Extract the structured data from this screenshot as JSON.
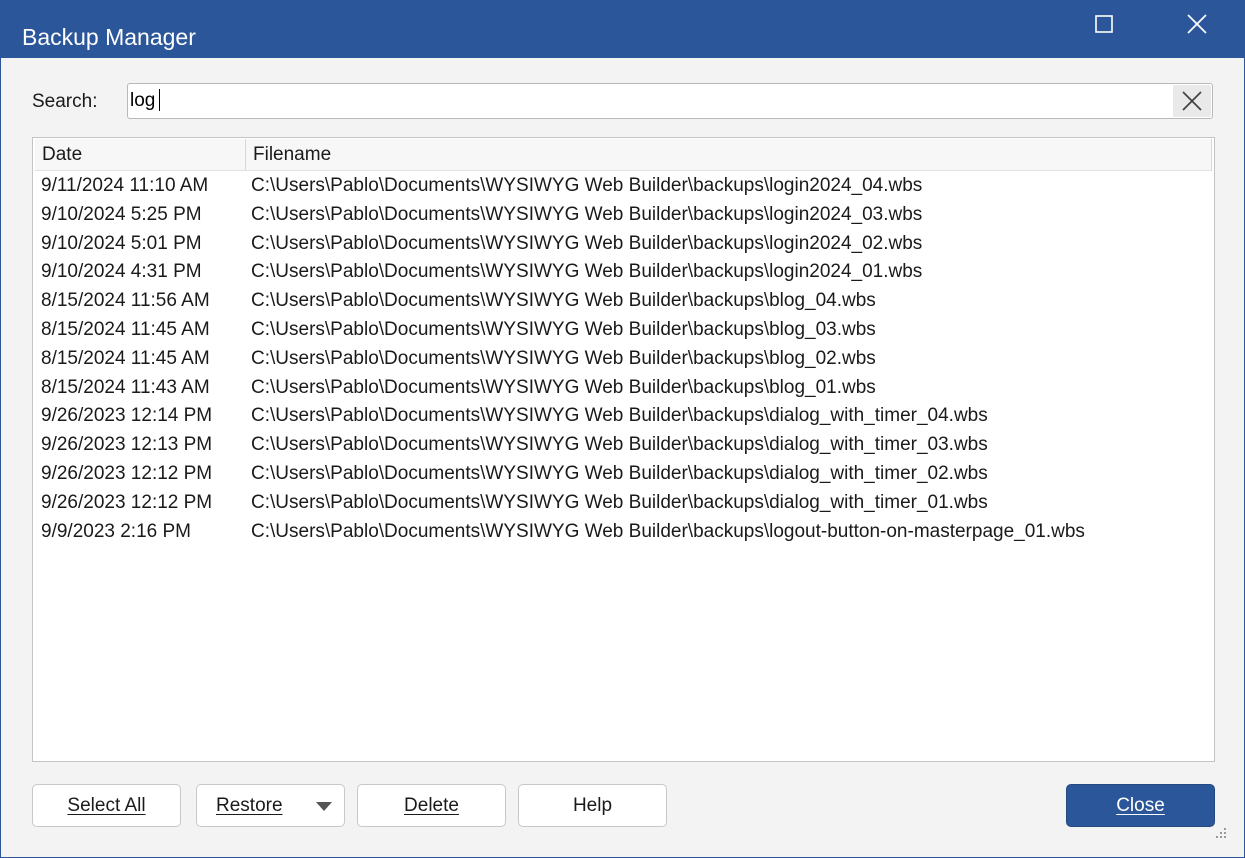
{
  "window": {
    "title": "Backup Manager",
    "maximize_icon": "maximize-icon",
    "close_icon": "close-icon",
    "accent": "#2b579a"
  },
  "search": {
    "label": "Search:",
    "value": "log",
    "clear_icon": "clear-x-icon"
  },
  "table": {
    "columns": [
      "Date",
      "Filename"
    ],
    "rows": [
      {
        "date": "9/11/2024 11:10 AM",
        "filename": "C:\\Users\\Pablo\\Documents\\WYSIWYG Web Builder\\backups\\login2024_04.wbs"
      },
      {
        "date": "9/10/2024 5:25 PM",
        "filename": "C:\\Users\\Pablo\\Documents\\WYSIWYG Web Builder\\backups\\login2024_03.wbs"
      },
      {
        "date": "9/10/2024 5:01 PM",
        "filename": "C:\\Users\\Pablo\\Documents\\WYSIWYG Web Builder\\backups\\login2024_02.wbs"
      },
      {
        "date": "9/10/2024 4:31 PM",
        "filename": "C:\\Users\\Pablo\\Documents\\WYSIWYG Web Builder\\backups\\login2024_01.wbs"
      },
      {
        "date": "8/15/2024 11:56 AM",
        "filename": "C:\\Users\\Pablo\\Documents\\WYSIWYG Web Builder\\backups\\blog_04.wbs"
      },
      {
        "date": "8/15/2024 11:45 AM",
        "filename": "C:\\Users\\Pablo\\Documents\\WYSIWYG Web Builder\\backups\\blog_03.wbs"
      },
      {
        "date": "8/15/2024 11:45 AM",
        "filename": "C:\\Users\\Pablo\\Documents\\WYSIWYG Web Builder\\backups\\blog_02.wbs"
      },
      {
        "date": "8/15/2024 11:43 AM",
        "filename": "C:\\Users\\Pablo\\Documents\\WYSIWYG Web Builder\\backups\\blog_01.wbs"
      },
      {
        "date": "9/26/2023 12:14 PM",
        "filename": "C:\\Users\\Pablo\\Documents\\WYSIWYG Web Builder\\backups\\dialog_with_timer_04.wbs"
      },
      {
        "date": "9/26/2023 12:13 PM",
        "filename": "C:\\Users\\Pablo\\Documents\\WYSIWYG Web Builder\\backups\\dialog_with_timer_03.wbs"
      },
      {
        "date": "9/26/2023 12:12 PM",
        "filename": "C:\\Users\\Pablo\\Documents\\WYSIWYG Web Builder\\backups\\dialog_with_timer_02.wbs"
      },
      {
        "date": "9/26/2023 12:12 PM",
        "filename": "C:\\Users\\Pablo\\Documents\\WYSIWYG Web Builder\\backups\\dialog_with_timer_01.wbs"
      },
      {
        "date": "9/9/2023 2:16 PM",
        "filename": "C:\\Users\\Pablo\\Documents\\WYSIWYG Web Builder\\backups\\logout-button-on-masterpage_01.wbs"
      }
    ]
  },
  "buttons": {
    "select_all": "Select All",
    "restore": "Restore",
    "restore_icon": "dropdown-arrow-icon",
    "delete": "Delete",
    "help": "Help",
    "close": "Close"
  },
  "footer": {
    "grip_icon": "resize-grip-icon"
  }
}
